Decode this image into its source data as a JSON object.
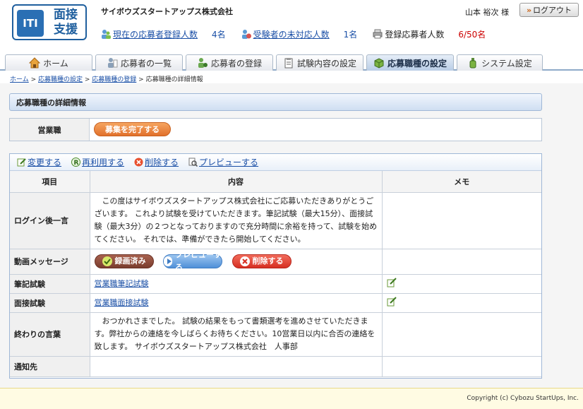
{
  "header": {
    "logo_mark": "ITI",
    "logo_text": "面接\n支援",
    "company": "サイボウズスタートアップス株式会社",
    "user": "山本 裕次 様",
    "logout_label": "ログアウト"
  },
  "stats": [
    {
      "label": "現在の応募者登録人数",
      "value": "4名",
      "link": true
    },
    {
      "label": "受験者の未対応人数",
      "value": "1名",
      "link": true
    },
    {
      "label": "登録応募者人数",
      "value": "6/50名",
      "link": false
    }
  ],
  "tabs": [
    {
      "label": "ホーム"
    },
    {
      "label": "応募者の一覧"
    },
    {
      "label": "応募者の登録"
    },
    {
      "label": "試験内容の設定"
    },
    {
      "label": "応募職種の設定",
      "active": true
    },
    {
      "label": "システム設定"
    }
  ],
  "breadcrumb": {
    "items": [
      "ホーム",
      "応募職種の設定",
      "応募職種の登録"
    ],
    "current": "応募職種の詳細情報",
    "sep": " > "
  },
  "section_title": "応募職種の詳細情報",
  "job": {
    "name": "営業職",
    "finish_label": "募集を完了する"
  },
  "actions": [
    {
      "label": "変更する",
      "icon": "edit-icon"
    },
    {
      "label": "再利用する",
      "icon": "reuse-icon"
    },
    {
      "label": "削除する",
      "icon": "delete-icon"
    },
    {
      "label": "プレビューする",
      "icon": "preview-icon"
    }
  ],
  "table": {
    "headers": [
      "項目",
      "内容",
      "メモ"
    ],
    "rows": {
      "login": {
        "label": "ログイン後一言",
        "content": "この度はサイボウズスタートアップス株式会社にご応募いただきありがとうございます。 これより試験を受けていただきます。筆記試験（最大15分）、面接試験（最大3分）の２つとなっておりますので充分時間に余裕を持って、試験を始めてください。 それでは、準備ができたら開始してください。"
      },
      "video": {
        "label": "動画メッセージ",
        "recorded": "録画済み",
        "preview": "プレビューする",
        "delete": "削除する"
      },
      "written": {
        "label": "筆記試験",
        "link": "営業職筆記試験"
      },
      "interview": {
        "label": "面接試験",
        "link": "営業職面接試験"
      },
      "closing": {
        "label": "終わりの言葉",
        "content": "おつかれさまでした。 試験の結果をもって書類選考を進めさせていただきます。弊社からの連絡を今しばらくお待ちください。10営業日以内に合否の連絡を致します。 サイボウズスタートアップス株式会社　人事部"
      },
      "notify": {
        "label": "通知先"
      }
    }
  },
  "footer": {
    "copyright": "Copyright (c) Cybozu StartUps, Inc."
  },
  "colors": {
    "link": "#1a4fa6",
    "accent_orange": "#e1702a",
    "count_red": "#cc0000",
    "brand_blue": "#1f5f9e"
  }
}
